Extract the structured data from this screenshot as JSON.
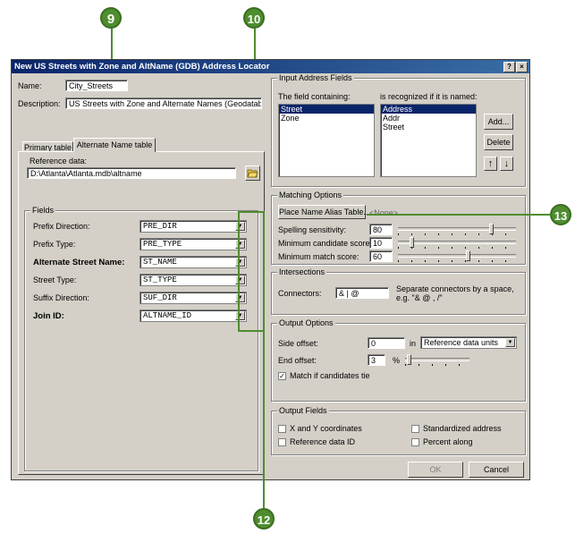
{
  "callouts": {
    "c9": "9",
    "c10": "10",
    "c12": "12",
    "c13": "13"
  },
  "colors": {
    "callout": "#4f8d2f",
    "title_start": "#0a246a",
    "title_end": "#3a6ea5",
    "face": "#d4d0c8"
  },
  "window": {
    "title": "New US Streets with Zone and AltName (GDB) Address Locator",
    "help_btn": "?",
    "close_btn": "×"
  },
  "left": {
    "name_label": "Name:",
    "name_value": "City_Streets",
    "desc_label": "Description:",
    "desc_value": "US Streets with Zone and Alternate Names (Geodatabas",
    "tabs": [
      "Primary table",
      "Alternate Name table"
    ],
    "ref_label": "Reference data:",
    "ref_value": "D:\\Atlanta\\Atlanta.mdb\\altname",
    "browse_icon": "folder-open-icon",
    "fields_title": "Fields",
    "fields": [
      {
        "label": "Prefix Direction:",
        "value": "PRE_DIR",
        "bold": false
      },
      {
        "label": "Prefix Type:",
        "value": "PRE_TYPE",
        "bold": false
      },
      {
        "label": "Alternate Street Name:",
        "value": "ST_NAME",
        "bold": true
      },
      {
        "label": "Street Type:",
        "value": "ST_TYPE",
        "bold": false
      },
      {
        "label": "Suffix Direction:",
        "value": "SUF_DIR",
        "bold": false
      },
      {
        "label": "Join ID:",
        "value": "ALTNAME_ID",
        "bold": true
      }
    ]
  },
  "input": {
    "title": "Input Address Fields",
    "containing_label": "The field containing:",
    "recognized_label": "is recognized if it is named:",
    "fields": [
      "Street",
      "Zone"
    ],
    "names": [
      "Address",
      "Addr",
      "Street"
    ],
    "add": "Add...",
    "delete": "Delete",
    "up": "↑",
    "down": "↓"
  },
  "matching": {
    "title": "Matching Options",
    "alias_btn": "Place Name Alias Table...",
    "alias_value": "<None>",
    "spelling_label": "Spelling sensitivity:",
    "spelling_value": "80",
    "spelling_level": 0.8,
    "mincand_label": "Minimum candidate score:",
    "mincand_value": "10",
    "mincand_level": 0.1,
    "minmatch_label": "Minimum match score:",
    "minmatch_value": "60",
    "minmatch_level": 0.6
  },
  "intersections": {
    "title": "Intersections",
    "connectors_label": "Connectors:",
    "connectors_value": "& | @",
    "help": "Separate connectors by a space, e.g. \"& @ , /\""
  },
  "output": {
    "title": "Output Options",
    "side_label": "Side offset:",
    "side_value": "0",
    "in_label": "in",
    "units": "Reference data units",
    "end_label": "End offset:",
    "end_value": "3",
    "pct": "%",
    "end_level": 0.03,
    "tie_label": "Match if candidates tie",
    "tie_checked": true
  },
  "outfields": {
    "title": "Output Fields",
    "xy": "X and Y coordinates",
    "refid": "Reference data ID",
    "std": "Standardized address",
    "pct": "Percent along"
  },
  "buttons": {
    "ok": "OK",
    "cancel": "Cancel"
  }
}
